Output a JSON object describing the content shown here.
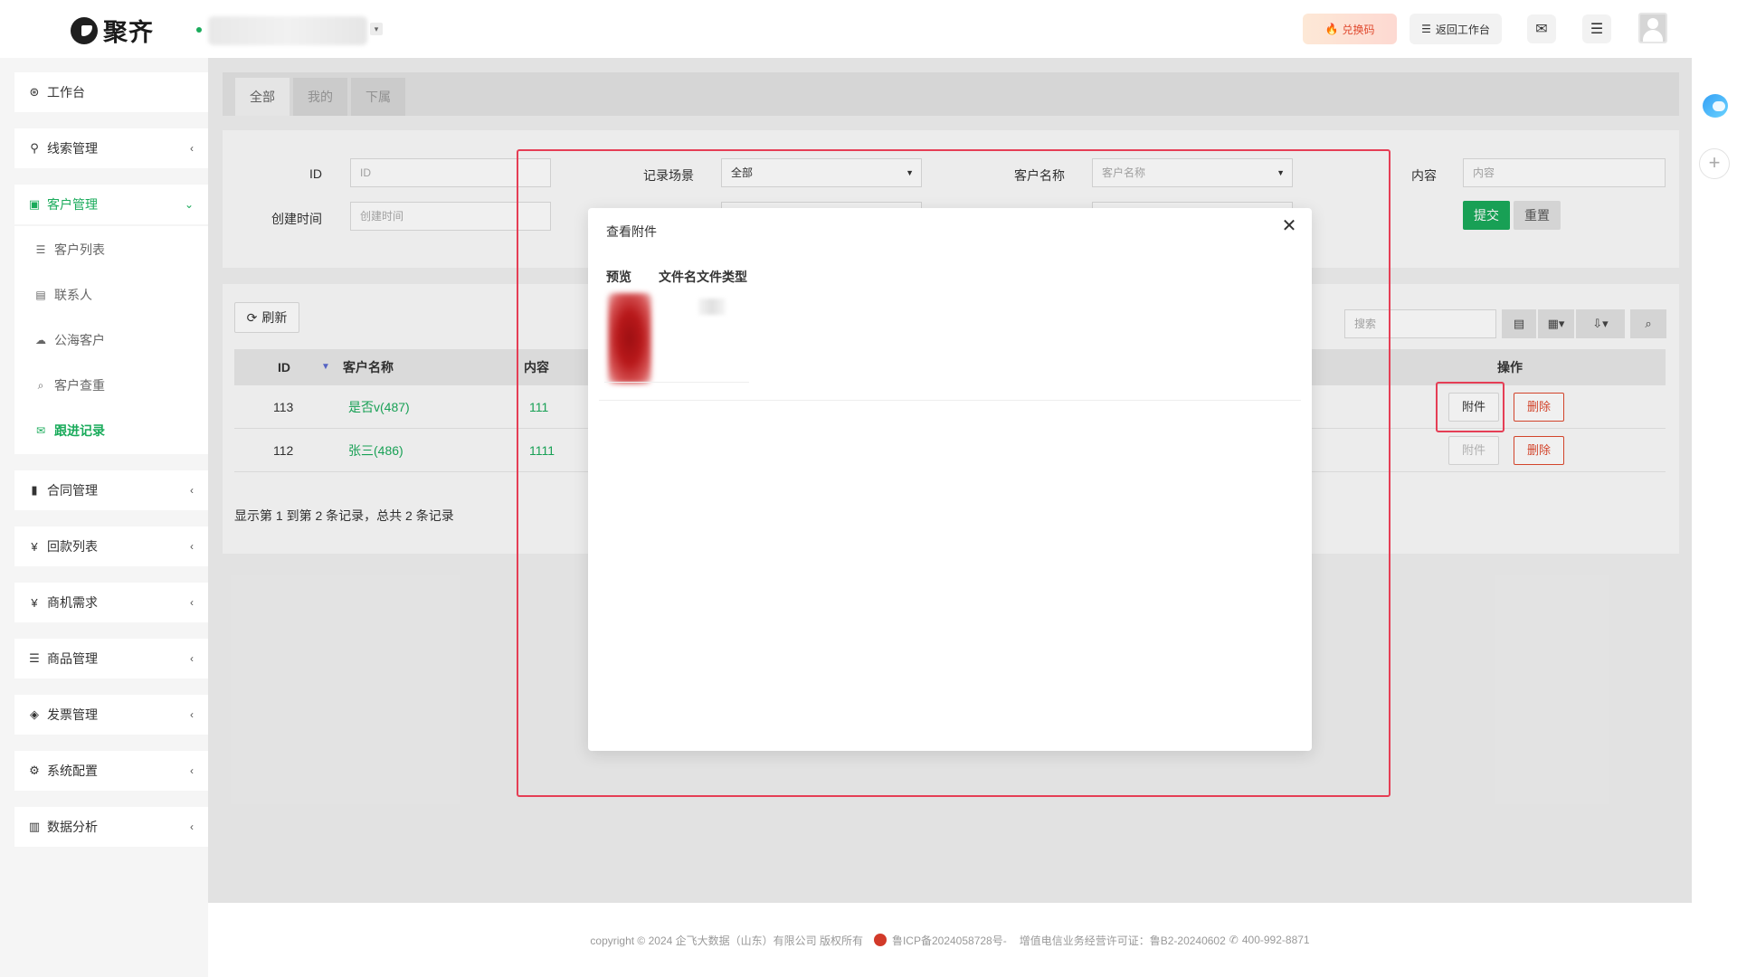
{
  "app": {
    "logo_text": "聚齐"
  },
  "header": {
    "redeem_label": "兑换码",
    "back_label": "返回工作台",
    "icons": [
      "flame-icon",
      "list-icon",
      "mail-icon",
      "menu-icon",
      "avatar"
    ]
  },
  "sidebar": {
    "items": [
      {
        "label": "工作台",
        "icon": "dashboard-icon",
        "glyph": "⊛"
      },
      {
        "label": "线索管理",
        "icon": "link-icon",
        "glyph": "⚲"
      },
      {
        "label": "客户管理",
        "icon": "id-card-icon",
        "glyph": "▣"
      },
      {
        "label": "合同管理",
        "icon": "bookmark-icon",
        "glyph": "▮"
      },
      {
        "label": "回款列表",
        "icon": "yen-icon",
        "glyph": "¥"
      },
      {
        "label": "商机需求",
        "icon": "yen-icon",
        "glyph": "¥"
      },
      {
        "label": "商品管理",
        "icon": "list-icon",
        "glyph": "☰"
      },
      {
        "label": "发票管理",
        "icon": "tag-icon",
        "glyph": "◈"
      },
      {
        "label": "系统配置",
        "icon": "gears-icon",
        "glyph": "⚙"
      },
      {
        "label": "数据分析",
        "icon": "bar-chart-icon",
        "glyph": "▥"
      }
    ],
    "submenu": [
      {
        "label": "客户列表",
        "icon": "list-icon",
        "glyph": "☰"
      },
      {
        "label": "联系人",
        "icon": "contact-icon",
        "glyph": "▤"
      },
      {
        "label": "公海客户",
        "icon": "cloud-icon",
        "glyph": "☁"
      },
      {
        "label": "客户查重",
        "icon": "search-icon",
        "glyph": "⌕"
      },
      {
        "label": "跟进记录",
        "icon": "chat-icon",
        "glyph": "✉"
      }
    ]
  },
  "tabs": [
    "全部",
    "我的",
    "下属"
  ],
  "filters": {
    "id_label": "ID",
    "id_placeholder": "ID",
    "created_label": "创建时间",
    "created_placeholder": "创建时间",
    "scene_label": "记录场景",
    "scene_value": "全部",
    "customer_label": "客户名称",
    "customer_placeholder": "客户名称",
    "content_label": "内容",
    "content_placeholder": "内容",
    "submit_label": "提交",
    "reset_label": "重置"
  },
  "toolbar": {
    "refresh_label": "刷新",
    "search_placeholder": "搜索"
  },
  "table": {
    "headers": {
      "id": "ID",
      "customer": "客户名称",
      "content": "内容",
      "ops": "操作"
    },
    "rows": [
      {
        "id": "113",
        "customer": "是否v(487)",
        "content": "111",
        "attach": "附件",
        "delete": "删除"
      },
      {
        "id": "112",
        "customer": "张三(486)",
        "content": "1111",
        "attach": "附件",
        "delete": "删除"
      }
    ],
    "pager": "显示第 1 到第 2 条记录，总共 2 条记录"
  },
  "modal": {
    "title": "查看附件",
    "col_preview": "预览",
    "col_filename": "文件名",
    "col_filetype": "文件类型"
  },
  "footer": {
    "copyright": "copyright © 2024 企飞大数据（山东）有限公司 版权所有",
    "icp": "鲁ICP备2024058728号-",
    "license": "增值电信业务经营许可证：鲁B2-20240602",
    "phone": "400-992-8871"
  },
  "colors": {
    "brand": "#1aab5b",
    "danger": "#e0492e",
    "highlight": "#e53e55"
  }
}
